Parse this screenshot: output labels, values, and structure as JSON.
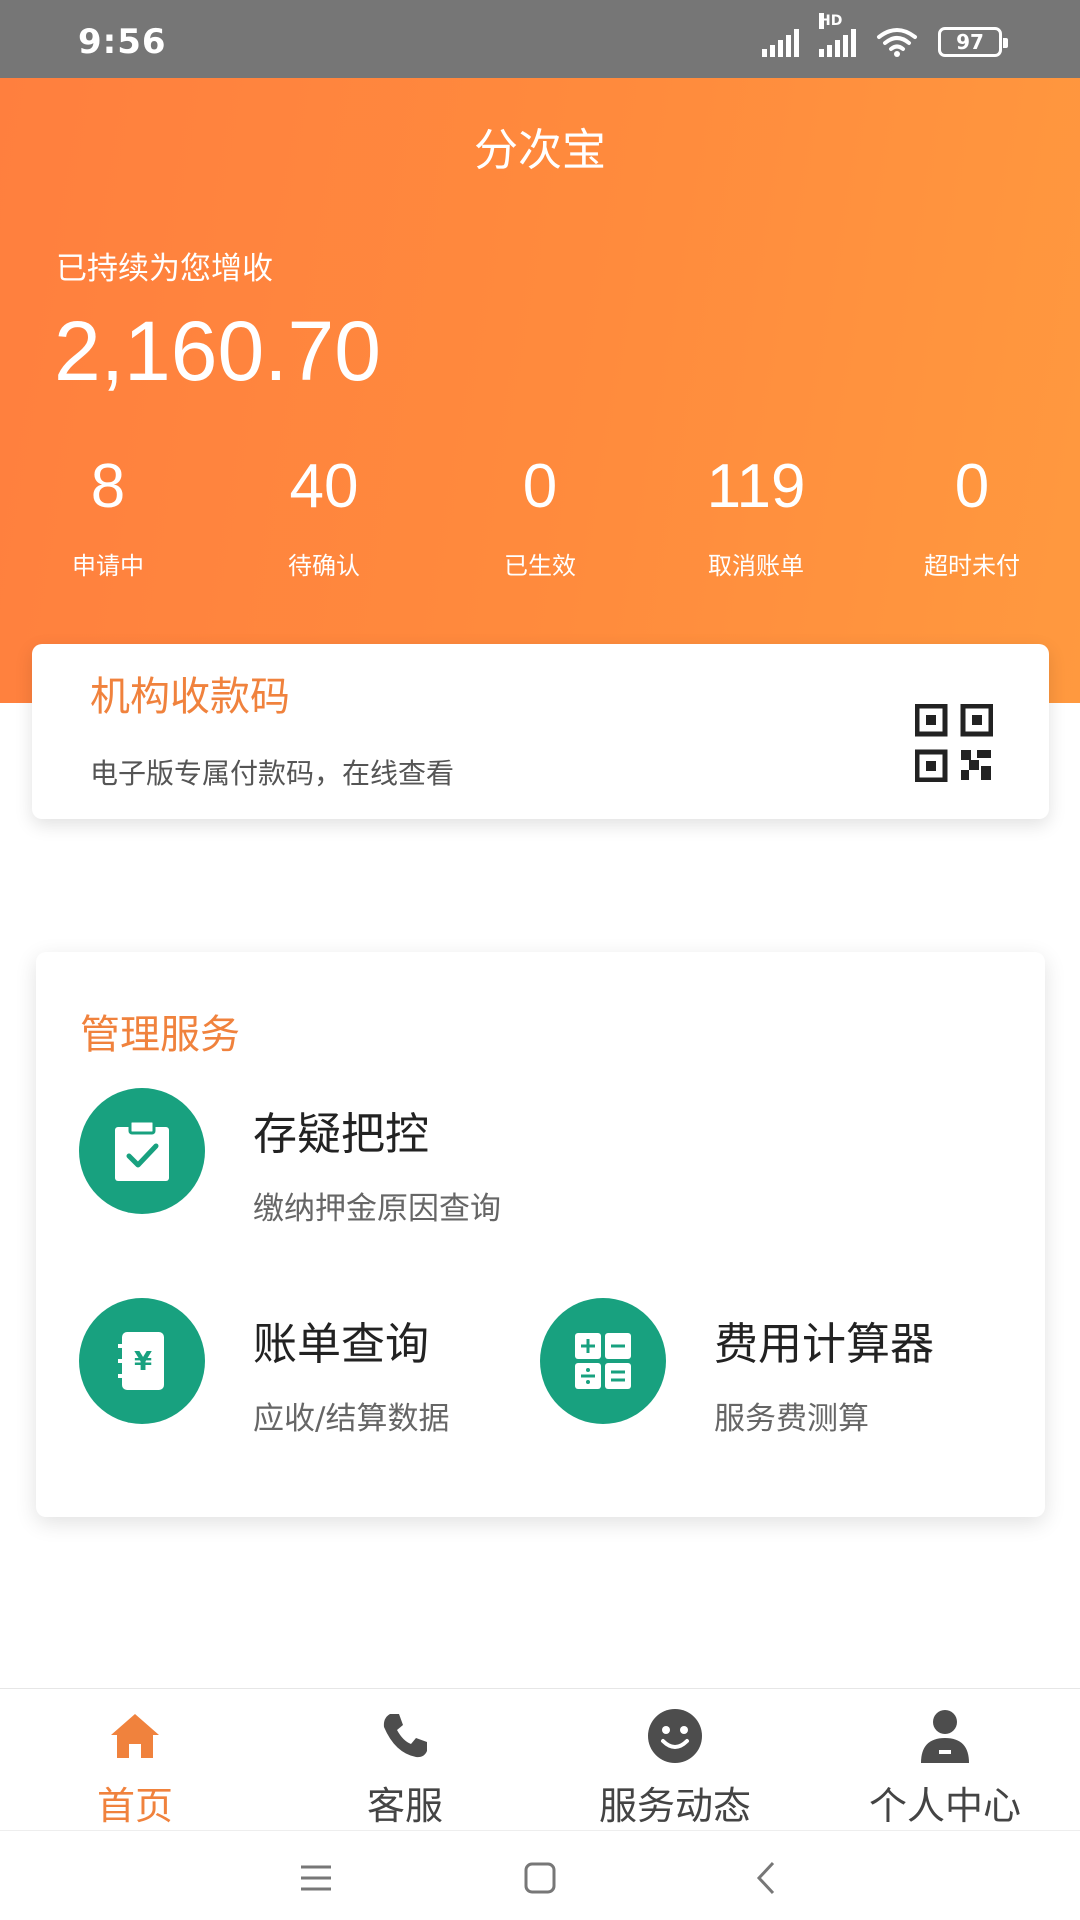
{
  "status_bar": {
    "time": "9:56",
    "network_label": "HD",
    "battery": "97"
  },
  "header": {
    "title": "分次宝",
    "growth_label": "已持续为您增收",
    "growth_amount": "2,160.70"
  },
  "stats": [
    {
      "value": "8",
      "label": "申请中"
    },
    {
      "value": "40",
      "label": "待确认"
    },
    {
      "value": "0",
      "label": "已生效"
    },
    {
      "value": "119",
      "label": "取消账单"
    },
    {
      "value": "0",
      "label": "超时未付"
    }
  ],
  "qr_card": {
    "title": "机构收款码",
    "subtitle": "电子版专属付款码，在线查看",
    "icon": "qr-code-icon"
  },
  "management": {
    "title": "管理服务",
    "items": [
      {
        "name": "存疑把控",
        "desc": "缴纳押金原因查询",
        "icon": "clipboard-check-icon"
      },
      {
        "name": "账单查询",
        "desc": "应收/结算数据",
        "icon": "bill-yen-icon"
      },
      {
        "name": "费用计算器",
        "desc": "服务费测算",
        "icon": "calculator-icon"
      }
    ]
  },
  "tabbar": [
    {
      "label": "首页",
      "icon": "home-icon",
      "active": true
    },
    {
      "label": "客服",
      "icon": "phone-icon",
      "active": false
    },
    {
      "label": "服务动态",
      "icon": "smiley-icon",
      "active": false
    },
    {
      "label": "个人中心",
      "icon": "person-icon",
      "active": false
    }
  ],
  "colors": {
    "accent": "#f0823d",
    "header_gradient_start": "#ff7f3e",
    "header_gradient_end": "#ff993f",
    "service_green": "#18a17f",
    "status_bar": "#767676"
  }
}
